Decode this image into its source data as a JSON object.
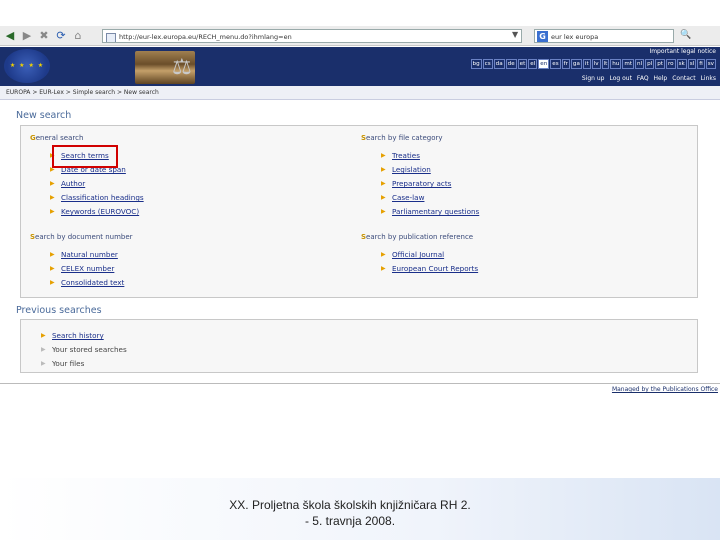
{
  "browser": {
    "address_url": "http://eur-lex.europa.eu/RECH_menu.do?ihmlang=en",
    "search_box": "eur lex europa"
  },
  "header": {
    "logo_text": "EUR-Lex",
    "important_notice": "Important legal notice",
    "languages": [
      "bg",
      "cs",
      "da",
      "de",
      "et",
      "el",
      "en",
      "es",
      "fr",
      "ga",
      "it",
      "lv",
      "lt",
      "hu",
      "mt",
      "nl",
      "pl",
      "pt",
      "ro",
      "sk",
      "sl",
      "fi",
      "sv"
    ],
    "selected_language": "en",
    "topnav": [
      "Sign up",
      "Log out",
      "FAQ",
      "Help",
      "Contact",
      "Links"
    ]
  },
  "breadcrumb": "EUROPA > EUR-Lex > Simple search > New search",
  "new_search": {
    "title": "New search",
    "groups": [
      {
        "title_first": "G",
        "title_rest": "eneral search",
        "items": [
          "Search terms",
          "Date or date span",
          "Author",
          "Classification headings",
          "Keywords (EUROVOC)"
        ]
      },
      {
        "title_first": "S",
        "title_rest": "earch by file category",
        "items": [
          "Treaties",
          "Legislation",
          "Preparatory acts",
          "Case-law",
          "Parliamentary questions"
        ]
      },
      {
        "title_first": "S",
        "title_rest": "earch by document number",
        "items": [
          "Natural number",
          "CELEX number",
          "Consolidated text"
        ]
      },
      {
        "title_first": "S",
        "title_rest": "earch by publication reference",
        "items": [
          "Official Journal",
          "European Court Reports"
        ]
      }
    ]
  },
  "previous_searches": {
    "title": "Previous searches",
    "items": [
      "Search history",
      "Your stored searches",
      "Your files"
    ]
  },
  "managed_by": "Managed by the Publications Office",
  "footer": {
    "line1": "XX. Proljetna škola školskih knjižničara RH 2.",
    "line2": "- 5. travnja 2008."
  },
  "colors": {
    "header_bg": "#1a2f6b",
    "link": "#1a2f8a",
    "highlight": "#d10000"
  }
}
